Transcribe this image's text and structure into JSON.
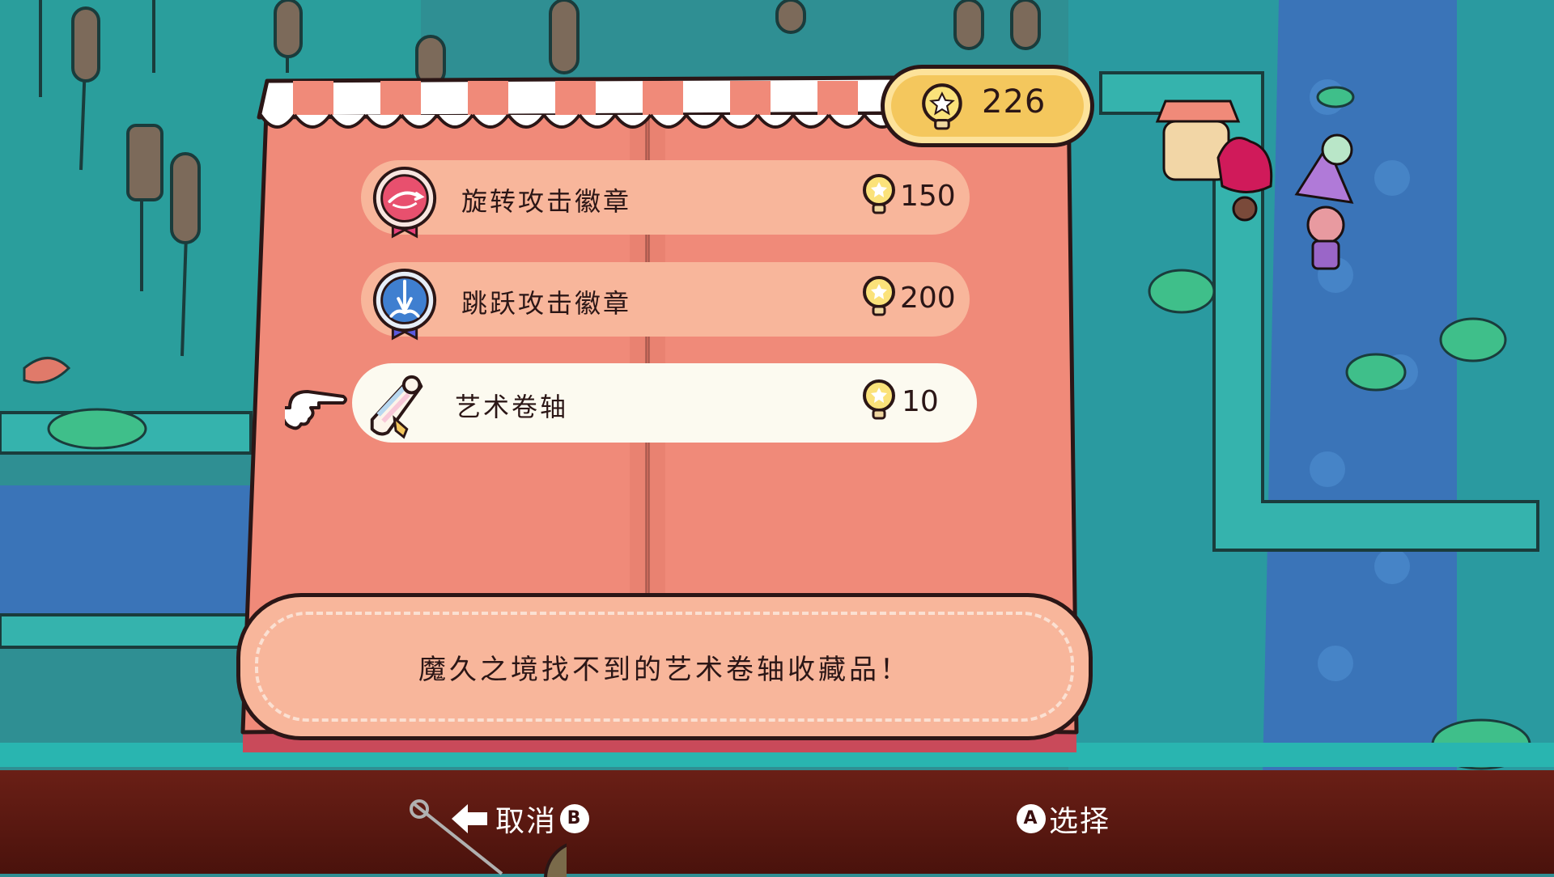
{
  "colors": {
    "page_pink": "#f08a79",
    "row_peach": "#f8b69b",
    "row_selected": "#fcfaf0",
    "water_teal": "#2f8f93",
    "coin_gold": "#f4c75d",
    "outline": "#2b1616"
  },
  "currency": {
    "icon": "lightbulb-coin-icon",
    "count": "226"
  },
  "shop": {
    "items": [
      {
        "name": "旋转攻击徽章",
        "price": "150",
        "icon": "spin-attack-badge-icon",
        "selected": false
      },
      {
        "name": "跳跃攻击徽章",
        "price": "200",
        "icon": "jump-attack-badge-icon",
        "selected": false
      },
      {
        "name": "艺术卷轴",
        "price": "10",
        "icon": "art-scroll-icon",
        "selected": true
      }
    ],
    "pointer_icon": "pointing-hand-icon"
  },
  "description": "魔久之境找不到的艺术卷轴收藏品！",
  "controls": {
    "cancel_label": "取消",
    "cancel_button": "B",
    "cancel_icon": "arrow-left-icon",
    "select_label": "选择",
    "select_button": "A"
  }
}
